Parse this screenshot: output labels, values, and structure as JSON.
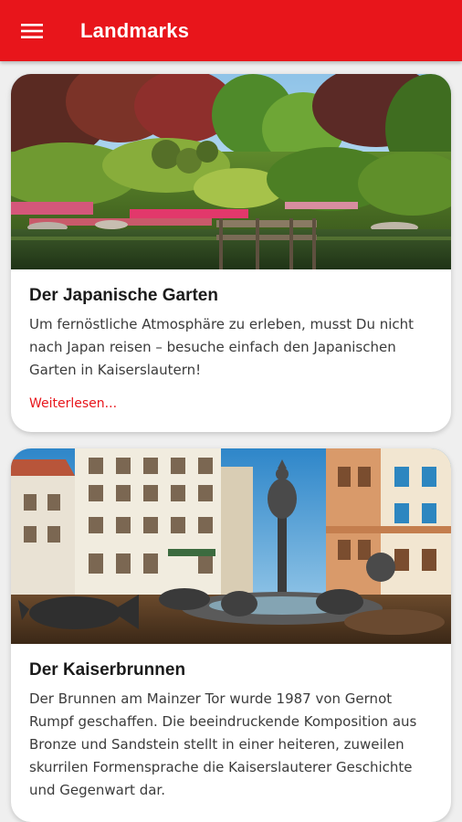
{
  "appbar": {
    "title": "Landmarks",
    "menu_icon": "hamburger-menu-icon",
    "color": "#e8151b"
  },
  "landmarks": [
    {
      "title": "Der Japanische Garten",
      "description": "Um fernöstliche Atmosphäre zu erleben, musst Du nicht nach Japan reisen – besuche einfach den Japanischen Garten in Kaiserslautern!",
      "link_label": "Weiterlesen...",
      "image": "japanese-garden-photo"
    },
    {
      "title": "Der Kaiserbrunnen",
      "description": "Der Brunnen am Mainzer Tor wurde 1987 von Gernot Rumpf geschaffen. Die beeindruckende Komposition aus Bronze und Sandstein stellt in einer heiteren, zuweilen skurrilen Formensprache die Kaiserslauterer Geschichte und Gegenwart dar.",
      "image": "kaiserbrunnen-fountain-photo"
    }
  ]
}
